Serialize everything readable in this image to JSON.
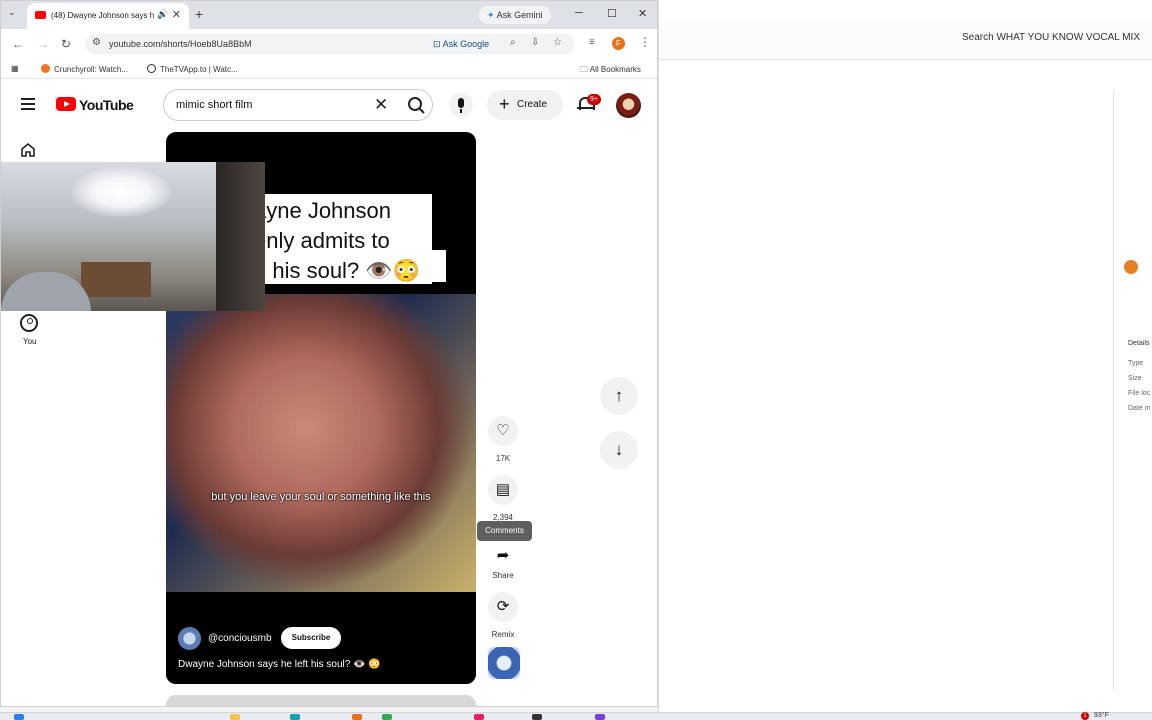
{
  "browser": {
    "tab_title": "(48) Dwayne Johnson says h",
    "ask_gemini": "Ask Gemini",
    "url": "youtube.com/shorts/Hoeb8Ua8BbM",
    "ask_google": "Ask Google",
    "profile_initial": "F",
    "bookmarks": [
      "Crunchyroll: Watch...",
      "TheTVApp.to | Watc..."
    ],
    "all_bookmarks": "All Bookmarks"
  },
  "youtube": {
    "logo_text": "YouTube",
    "search_value": "mimic short film",
    "create_label": "Create",
    "notification_badge": "9+",
    "sidebar_you": "You"
  },
  "short": {
    "caption_lines": [
      "ayne Johnson",
      "enly admits to",
      "g his soul? 👁️😳"
    ],
    "subtitle": "but you leave your soul or something like this",
    "channel": "@conciousmb",
    "subscribe_label": "Subscribe",
    "title": "Dwayne Johnson says he left his soul? 👁️ 😳"
  },
  "actions": {
    "likes": "17K",
    "comments": "2,394",
    "comments_tooltip": "Comments",
    "share": "Share",
    "remix": "Remix"
  },
  "background_window": {
    "search_text": "Search WHAT YOU KNOW VOCAL MIX",
    "details_labels": [
      "Details",
      "Type",
      "Size",
      "File loc",
      "Date m"
    ]
  },
  "taskbar": {
    "temperature": "93°F",
    "notif_count": "1"
  },
  "colors": {
    "youtube_red": "#ff0000",
    "badge_red": "#cc0000",
    "profile_orange": "#e8711a"
  }
}
